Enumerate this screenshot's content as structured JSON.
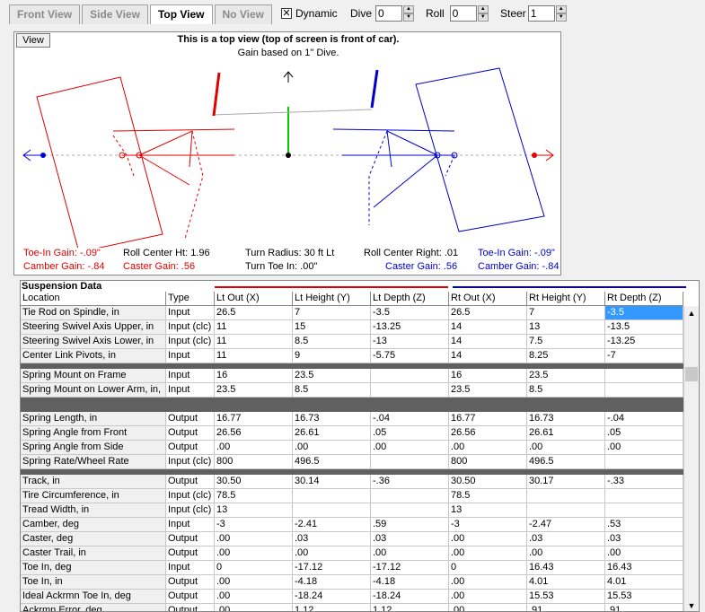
{
  "tabs": [
    "Front View",
    "Side View",
    "Top View",
    "No View"
  ],
  "controls": {
    "dynamic_label": "Dynamic",
    "dynamic_checked": "✕",
    "dive_label": "Dive",
    "dive_value": "0",
    "roll_label": "Roll",
    "roll_value": "0",
    "steer_label": "Steer",
    "steer_value": "1"
  },
  "view_panel": {
    "view_button": "View",
    "title": "This is a top view (top of screen is front of car).",
    "subtitle": "Gain based on 1\" Dive.",
    "toe_left": "Toe-In Gain: -.09\"",
    "camber_left": "Camber Gain: -.84",
    "roll_center_ht": "Roll Center Ht: 1.96",
    "caster_left": "Caster Gain: .56",
    "turn_radius": "Turn Radius: 30 ft Lt",
    "turn_toe": "Turn Toe In: .00\"",
    "roll_center_right": "Roll Center Right: .01",
    "caster_right": "Caster Gain: .56",
    "toe_right": "Toe-In Gain: -.09\"",
    "camber_right": "Camber Gain: -.84",
    "colors": {
      "left": "#e00000",
      "right": "#0000cc",
      "axis": "#00cc00"
    }
  },
  "grid": {
    "title": "Suspension Data",
    "headers": [
      "Location",
      "Type",
      "Lt Out (X)",
      "Lt Height (Y)",
      "Lt Depth (Z)",
      "Rt Out (X)",
      "Rt Height (Y)",
      "Rt Depth (Z)"
    ],
    "rows": [
      [
        "Tie Rod on Spindle, in",
        "Input",
        "26.5",
        "7",
        "-3.5",
        "26.5",
        "7",
        "-3.5"
      ],
      [
        "Steering Swivel Axis Upper, in",
        "Input (clc)",
        "11",
        "15",
        "-13.25",
        "14",
        "13",
        "-13.5"
      ],
      [
        "Steering Swivel Axis Lower, in",
        "Input (clc)",
        "11",
        "8.5",
        "-13",
        "14",
        "7.5",
        "-13.25"
      ],
      [
        "Center Link Pivots, in",
        "Input",
        "11",
        "9",
        "-5.75",
        "14",
        "8.25",
        "-7"
      ],
      [
        "Spring Mount on Frame",
        "Input",
        "16",
        "23.5",
        "",
        "16",
        "23.5",
        ""
      ],
      [
        "Spring Mount on Lower Arm, in,",
        "Input",
        "23.5",
        "8.5",
        "",
        "23.5",
        "8.5",
        ""
      ],
      [
        "Spring Length, in",
        "Output",
        "16.77",
        "16.73",
        "-.04",
        "16.77",
        "16.73",
        "-.04"
      ],
      [
        "Spring Angle from Front",
        "Output",
        "26.56",
        "26.61",
        ".05",
        "26.56",
        "26.61",
        ".05"
      ],
      [
        "Spring Angle from Side",
        "Output",
        ".00",
        ".00",
        ".00",
        ".00",
        ".00",
        ".00"
      ],
      [
        "Spring Rate/Wheel Rate",
        "Input (clc)",
        "800",
        "496.5",
        "",
        "800",
        "496.5",
        ""
      ],
      [
        "Track, in",
        "Output",
        "30.50",
        "30.14",
        "-.36",
        "30.50",
        "30.17",
        "-.33"
      ],
      [
        "Tire Circumference, in",
        "Input (clc)",
        "78.5",
        "",
        "",
        "78.5",
        "",
        ""
      ],
      [
        "Tread Width, in",
        "Input (clc)",
        "13",
        "",
        "",
        "13",
        "",
        ""
      ],
      [
        "Camber, deg",
        "Input",
        "-3",
        "-2.41",
        ".59",
        "-3",
        "-2.47",
        ".53"
      ],
      [
        "Caster, deg",
        "Output",
        ".00",
        ".03",
        ".03",
        ".00",
        ".03",
        ".03"
      ],
      [
        "Caster Trail, in",
        "Output",
        ".00",
        ".00",
        ".00",
        ".00",
        ".00",
        ".00"
      ],
      [
        "Toe In, deg",
        "Input",
        "0",
        "-17.12",
        "-17.12",
        "0",
        "16.43",
        "16.43"
      ],
      [
        "Toe In, in",
        "Output",
        ".00",
        "-4.18",
        "-4.18",
        ".00",
        "4.01",
        "4.01"
      ],
      [
        "Ideal Ackrmn Toe In, deg",
        "Output",
        ".00",
        "-18.24",
        "-18.24",
        ".00",
        "15.53",
        "15.53"
      ],
      [
        "Ackrmn Error, deg",
        "Output",
        ".00",
        "1.12",
        "1.12",
        ".00",
        ".91",
        ".91"
      ]
    ]
  }
}
